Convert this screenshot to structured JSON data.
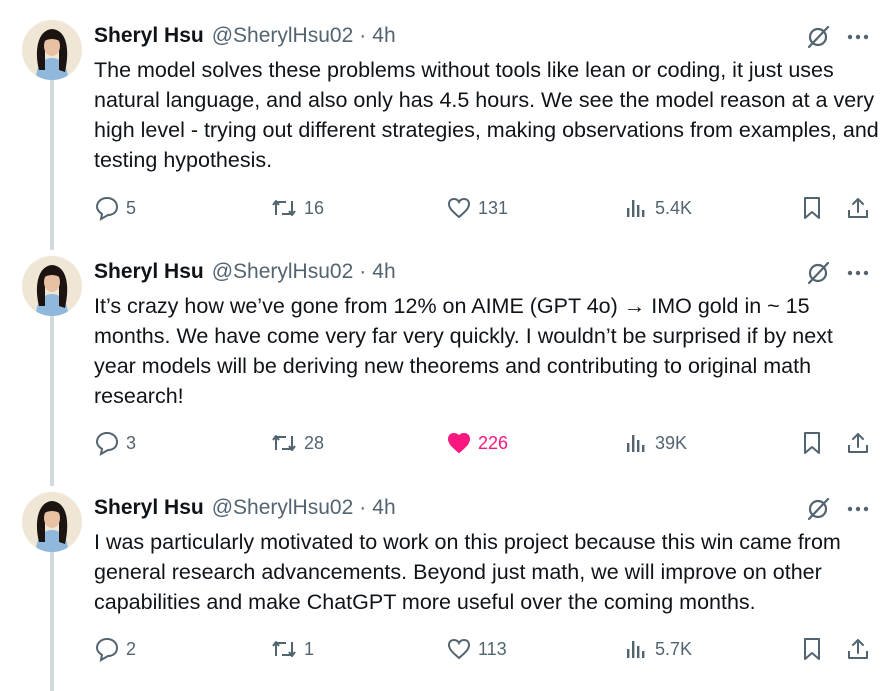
{
  "colors": {
    "text": "#0f1419",
    "muted": "#536471",
    "like_active": "#f91880",
    "thread_line": "#cfd9de"
  },
  "tweets": [
    {
      "author_name": "Sheryl Hsu",
      "handle": "@SherylHsu02",
      "separator": "·",
      "time": "4h",
      "text": "The model solves these problems without tools like lean or coding, it just uses natural language, and also only has 4.5 hours. We see the model reason at a very high level - trying out different strategies, making observations from examples, and testing hypothesis.",
      "replies": "5",
      "reposts": "16",
      "likes": "131",
      "views": "5.4K",
      "liked": false
    },
    {
      "author_name": "Sheryl Hsu",
      "handle": "@SherylHsu02",
      "separator": "·",
      "time": "4h",
      "text": "It’s crazy how we’ve gone from 12% on AIME (GPT 4o) → IMO gold in ~ 15 months. We have come very far very quickly. I wouldn’t be surprised if by next year models will be deriving new theorems and contributing to original math research!",
      "replies": "3",
      "reposts": "28",
      "likes": "226",
      "views": "39K",
      "liked": true
    },
    {
      "author_name": "Sheryl Hsu",
      "handle": "@SherylHsu02",
      "separator": "·",
      "time": "4h",
      "text": "I was particularly motivated to work on this project because this win came from general research advancements. Beyond just math, we will improve on other capabilities and make ChatGPT more useful over the coming months.",
      "replies": "2",
      "reposts": "1",
      "likes": "113",
      "views": "5.7K",
      "liked": false
    }
  ]
}
